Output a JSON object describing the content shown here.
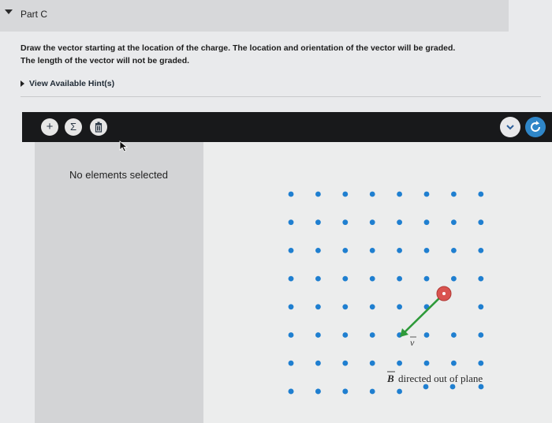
{
  "part": {
    "title": "Part C"
  },
  "instructions": {
    "line1": "Draw the vector starting at the location of the charge. The location and orientation of the vector will be graded.",
    "line2": "The length of the vector will not be graded."
  },
  "hint": {
    "label": "View Available Hint(s)"
  },
  "toolbar": {
    "add_icon": "plus-icon",
    "sum_icon": "sigma-icon",
    "delete_icon": "trash-icon",
    "sum_glyph": "Σ",
    "add_glyph": "+"
  },
  "side_panel": {
    "status": "No elements selected"
  },
  "figure": {
    "velocity_label": "v",
    "field_symbol": "B",
    "field_caption": "directed out of plane",
    "dot_color": "#1f7fd0",
    "vector_color": "#2e9a3a",
    "charge_color": "#d9534f"
  }
}
